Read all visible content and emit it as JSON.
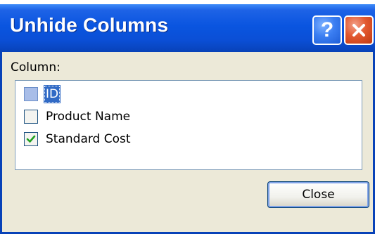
{
  "window": {
    "title": "Unhide Columns",
    "help_symbol": "?"
  },
  "dialog": {
    "column_label": "Column:",
    "items": [
      {
        "label": "ID",
        "checked": false,
        "selected": true
      },
      {
        "label": "Product Name",
        "checked": false,
        "selected": false
      },
      {
        "label": "Standard Cost",
        "checked": true,
        "selected": false
      }
    ],
    "close_label": "Close"
  },
  "icons": [
    "help-icon",
    "close-icon",
    "checkmark-icon"
  ],
  "colors": {
    "titlebar": "#0a55e0",
    "dialog_background": "#ece9d8",
    "selection": "#316ac5",
    "checkmark": "#21a121"
  }
}
